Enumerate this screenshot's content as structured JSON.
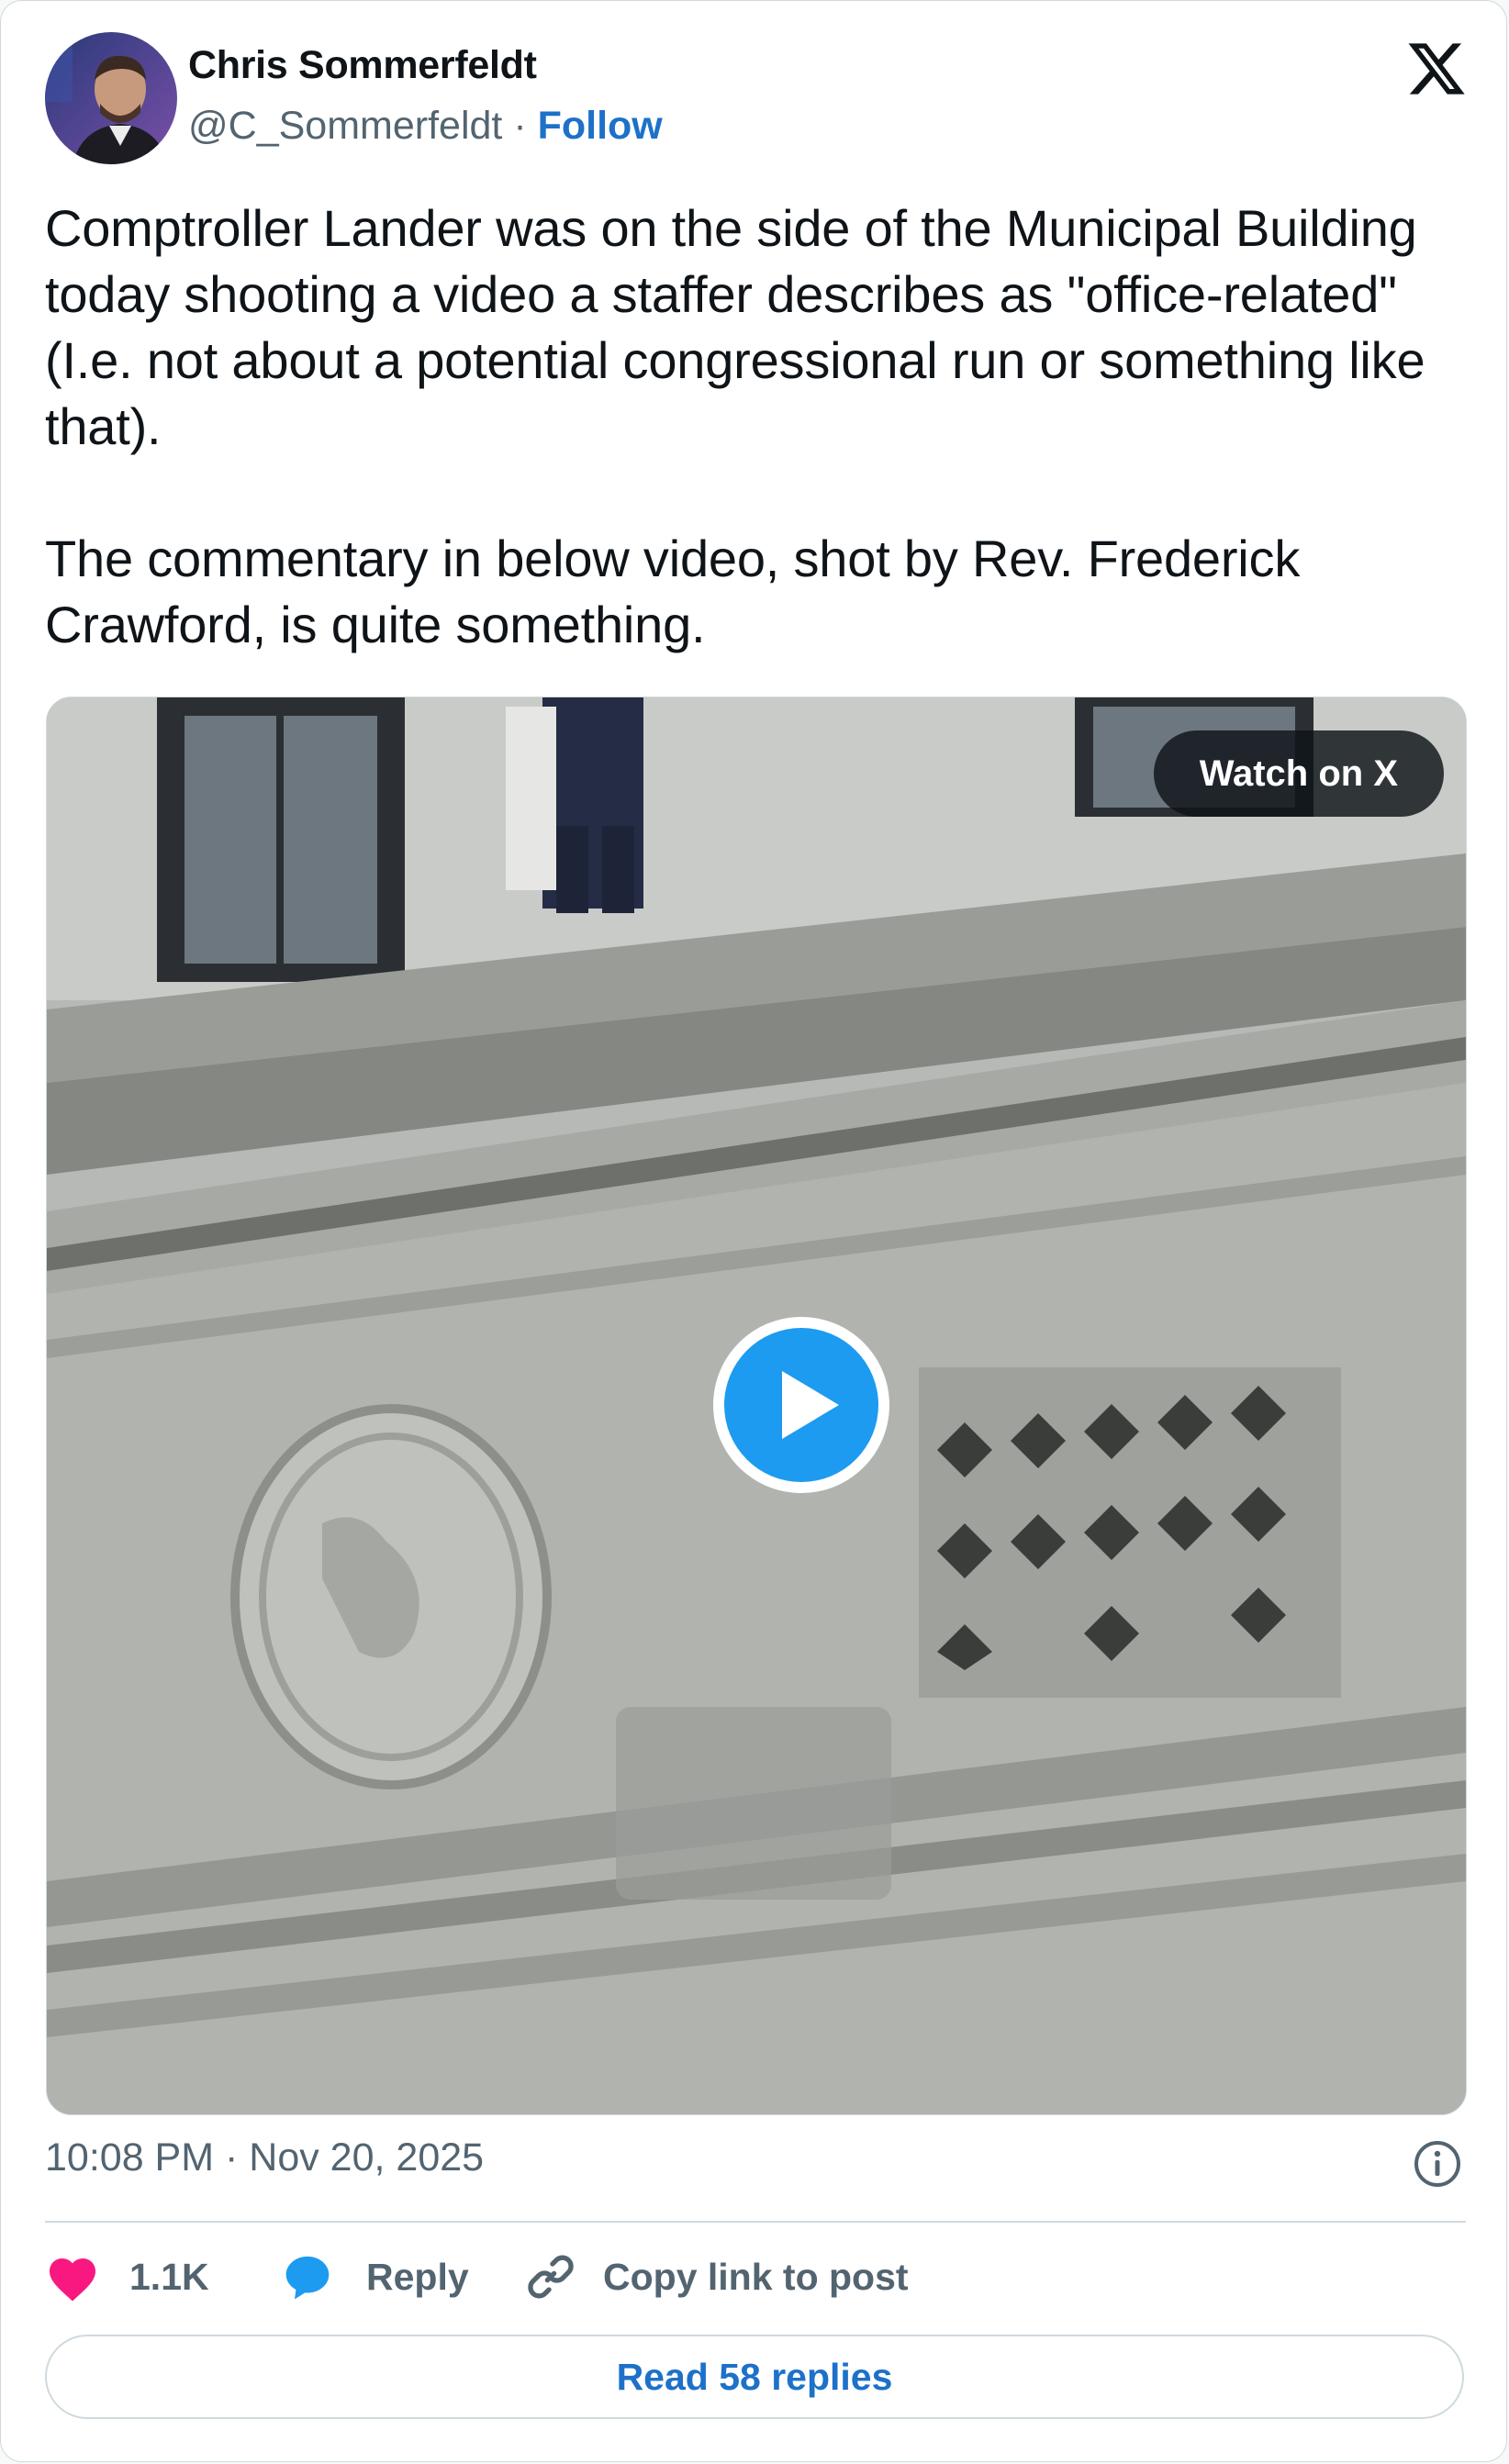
{
  "author": {
    "name": "Chris Sommerfeldt",
    "handle": "@C_Sommerfeldt",
    "separator": "·",
    "follow_label": "Follow"
  },
  "tweet": {
    "paragraph1": "Comptroller Lander was on the side of the Municipal Building today shooting a video a staffer describes as \"office-related\" (I.e. not about a potential congressional run or something like that).",
    "paragraph2": "The commentary in below video, shot by Rev. Frederick Crawford, is quite something."
  },
  "media": {
    "watch_label": "Watch on X",
    "play_icon": "play-icon"
  },
  "timestamp": "10:08 PM · Nov 20, 2025",
  "actions": {
    "likes_count": "1.1K",
    "reply_label": "Reply",
    "copy_label": "Copy link to post"
  },
  "read_replies_label": "Read 58 replies",
  "icons": [
    "x-logo-icon",
    "play-icon",
    "info-icon",
    "heart-icon",
    "reply-bubble-icon",
    "link-icon"
  ],
  "colors": {
    "link": "#1d71c8",
    "like": "#f91880",
    "reply": "#1d9bf0",
    "muted_text": "#536471",
    "border": "#cfd9de"
  }
}
